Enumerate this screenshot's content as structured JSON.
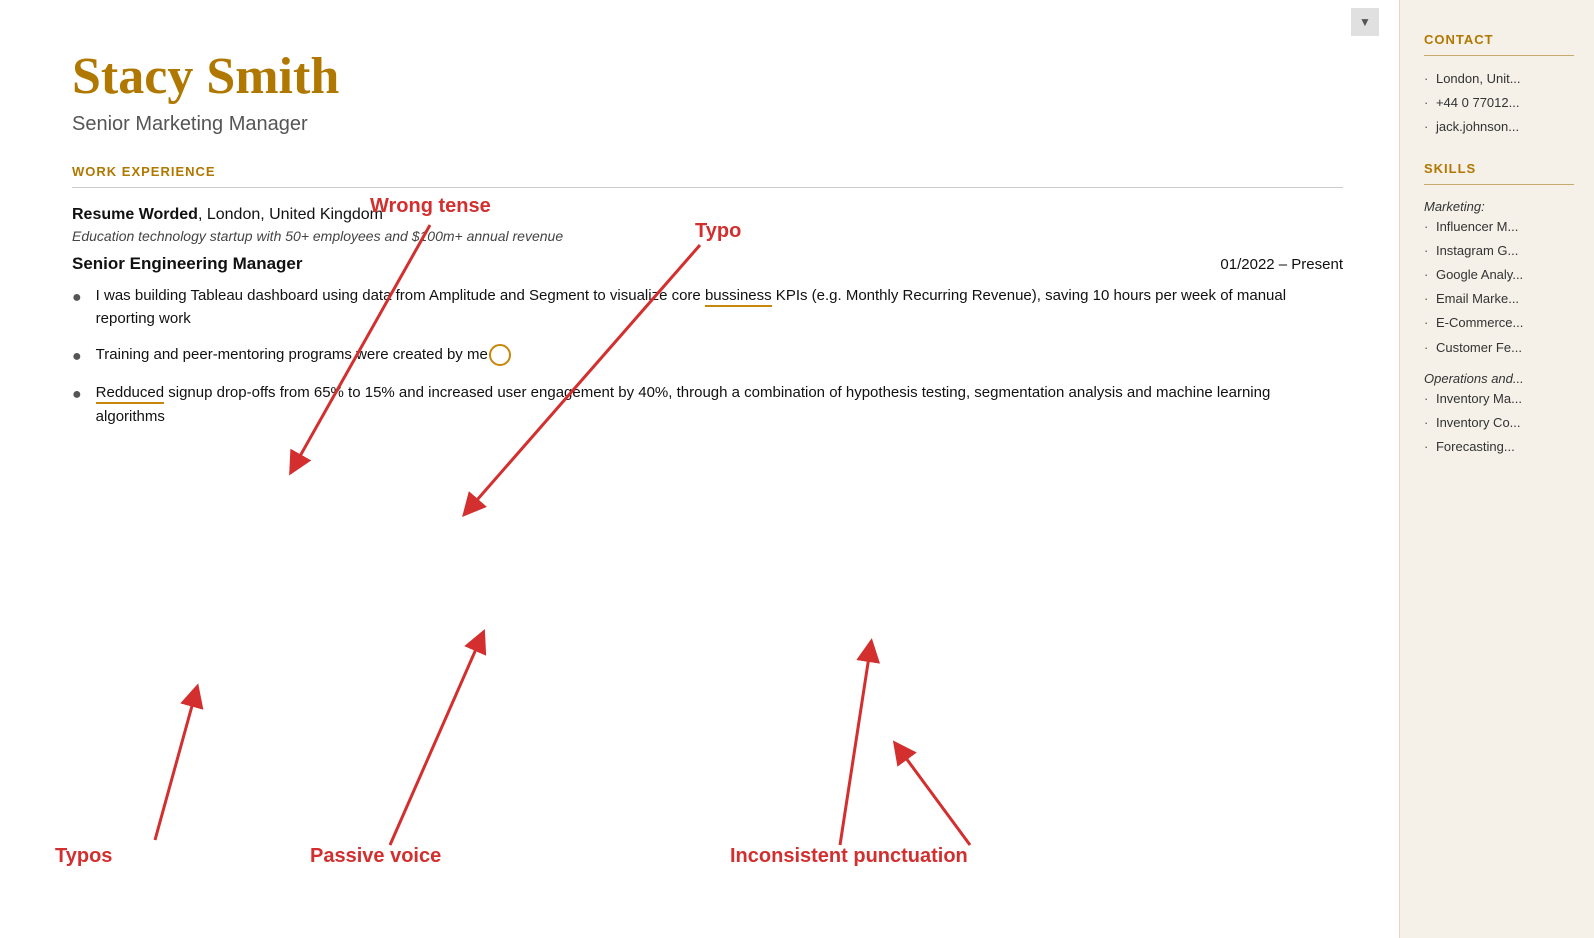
{
  "candidate": {
    "name": "Stacy Smith",
    "title": "Senior Marketing Manager"
  },
  "sections": {
    "work_experience_label": "WORK EXPERIENCE"
  },
  "work_entry": {
    "company": "Resume Worded",
    "location": "London, United Kingdom",
    "description": "Education technology startup with 50+ employees and $100m+ annual revenue",
    "job_title": "Senior Engineering Manager",
    "dates": "01/2022 – Present",
    "bullets": [
      {
        "id": 1,
        "text_before_typo": "I was building Tableau dashboard using data from Amplitude and Segment to visualize core ",
        "typo_word": "bussiness",
        "text_after_typo": " KPIs (e.g. Monthly Recurring Revenue), saving 10 hours per week of manual reporting work"
      },
      {
        "id": 2,
        "text": "Training and peer-mentoring programs were created by me."
      },
      {
        "id": 3,
        "text_before_typo": "",
        "typo_word": "Redduced",
        "text_after_typo": " signup drop-offs from 65% to 15% and increased user engagement by 40%, through a combination of hypothesis testing, segmentation analysis and machine learning algorithms"
      }
    ]
  },
  "annotations": {
    "wrong_tense": "Wrong tense",
    "typo_top": "Typo",
    "typos_bottom": "Typos",
    "passive_voice": "Passive voice",
    "inconsistent_punctuation": "Inconsistent punctuation"
  },
  "sidebar": {
    "contact_label": "CONTACT",
    "contact_items": [
      "London, Unit...",
      "+44 0 77012...",
      "jack.johnson..."
    ],
    "skills_label": "SKILLS",
    "skills_categories": [
      {
        "name": "Marketing:",
        "items": [
          "Influencer M...",
          "Instagram G...",
          "Google Analy...",
          "Email Marke...",
          "E-Commerce...",
          "Customer Fe..."
        ]
      },
      {
        "name": "Operations and...",
        "items": [
          "Inventory Ma...",
          "Inventory Co...",
          "Forecasting..."
        ]
      }
    ]
  }
}
